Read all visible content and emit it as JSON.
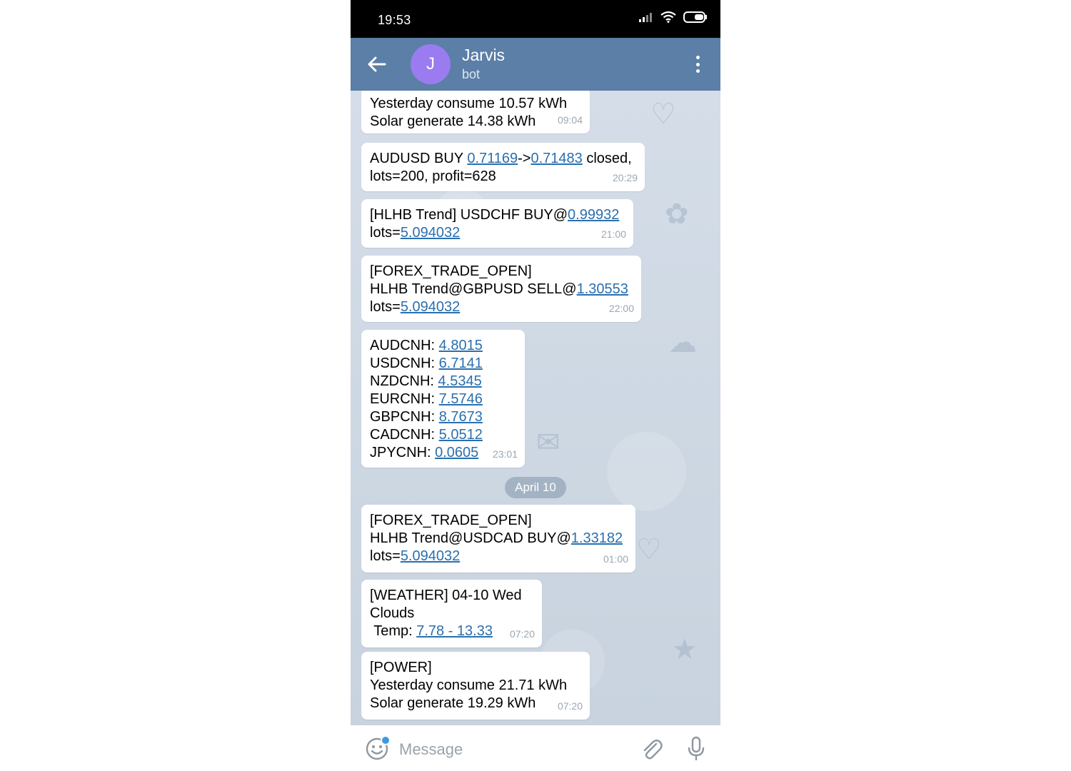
{
  "status_bar": {
    "time": "19:53"
  },
  "header": {
    "avatar_letter": "J",
    "title": "Jarvis",
    "subtitle": "bot"
  },
  "messages": [
    {
      "lines": [
        [
          {
            "t": "Yesterday consume 10.57 kWh"
          }
        ],
        [
          {
            "t": "Solar generate 14.38 kWh"
          }
        ]
      ],
      "time": "09:04"
    },
    {
      "lines": [
        [
          {
            "t": "AUDUSD BUY "
          },
          {
            "t": "0.71169",
            "link": true
          },
          {
            "t": "->"
          },
          {
            "t": "0.71483",
            "link": true
          },
          {
            "t": " closed,"
          }
        ],
        [
          {
            "t": "lots=200, profit=628"
          }
        ]
      ],
      "time": "20:29"
    },
    {
      "lines": [
        [
          {
            "t": "[HLHB Trend] USDCHF BUY@"
          },
          {
            "t": "0.99932",
            "link": true
          }
        ],
        [
          {
            "t": "lots="
          },
          {
            "t": "5.094032",
            "link": true
          }
        ]
      ],
      "time": "21:00"
    },
    {
      "lines": [
        [
          {
            "t": "[FOREX_TRADE_OPEN]"
          }
        ],
        [
          {
            "t": "HLHB Trend@GBPUSD SELL@"
          },
          {
            "t": "1.30553",
            "link": true
          }
        ],
        [
          {
            "t": "lots="
          },
          {
            "t": "5.094032",
            "link": true
          }
        ]
      ],
      "time": "22:00"
    },
    {
      "lines": [
        [
          {
            "t": "AUDCNH: "
          },
          {
            "t": "4.8015",
            "link": true
          }
        ],
        [
          {
            "t": "USDCNH: "
          },
          {
            "t": "6.7141",
            "link": true
          }
        ],
        [
          {
            "t": "NZDCNH: "
          },
          {
            "t": "4.5345",
            "link": true
          }
        ],
        [
          {
            "t": "EURCNH: "
          },
          {
            "t": "7.5746",
            "link": true
          }
        ],
        [
          {
            "t": "GBPCNH: "
          },
          {
            "t": "8.7673",
            "link": true
          }
        ],
        [
          {
            "t": "CADCNH: "
          },
          {
            "t": "5.0512",
            "link": true
          }
        ],
        [
          {
            "t": "JPYCNH: "
          },
          {
            "t": "0.0605",
            "link": true
          }
        ]
      ],
      "time": "23:01"
    },
    {
      "lines": [
        [
          {
            "t": "[FOREX_TRADE_OPEN]"
          }
        ],
        [
          {
            "t": "HLHB Trend@USDCAD BUY@"
          },
          {
            "t": "1.33182",
            "link": true
          }
        ],
        [
          {
            "t": "lots="
          },
          {
            "t": "5.094032",
            "link": true
          }
        ]
      ],
      "time": "01:00"
    },
    {
      "lines": [
        [
          {
            "t": "[WEATHER] 04-10 Wed"
          }
        ],
        [
          {
            "t": "Clouds"
          }
        ],
        [
          {
            "t": " Temp: "
          },
          {
            "t": "7.78 - 13.33",
            "link": true
          }
        ]
      ],
      "time": "07:20"
    },
    {
      "lines": [
        [
          {
            "t": "[POWER]"
          }
        ],
        [
          {
            "t": "Yesterday consume 21.71 kWh"
          }
        ],
        [
          {
            "t": "Solar generate 19.29 kWh"
          }
        ]
      ],
      "time": "07:20"
    }
  ],
  "date_separator": "April 10",
  "input": {
    "placeholder": "Message"
  },
  "icons": {
    "back": "arrow-left-icon",
    "menu": "more-vertical-icon",
    "signal": "signal-icon",
    "wifi": "wifi-icon",
    "battery": "battery-icon",
    "emoji": "emoji-icon",
    "attach": "paperclip-icon",
    "mic": "microphone-icon"
  },
  "colors": {
    "header": "#5b7fa6",
    "avatar": "#9b7cf0",
    "link": "#2a6fae",
    "chat_background": "#cfd9e4"
  }
}
